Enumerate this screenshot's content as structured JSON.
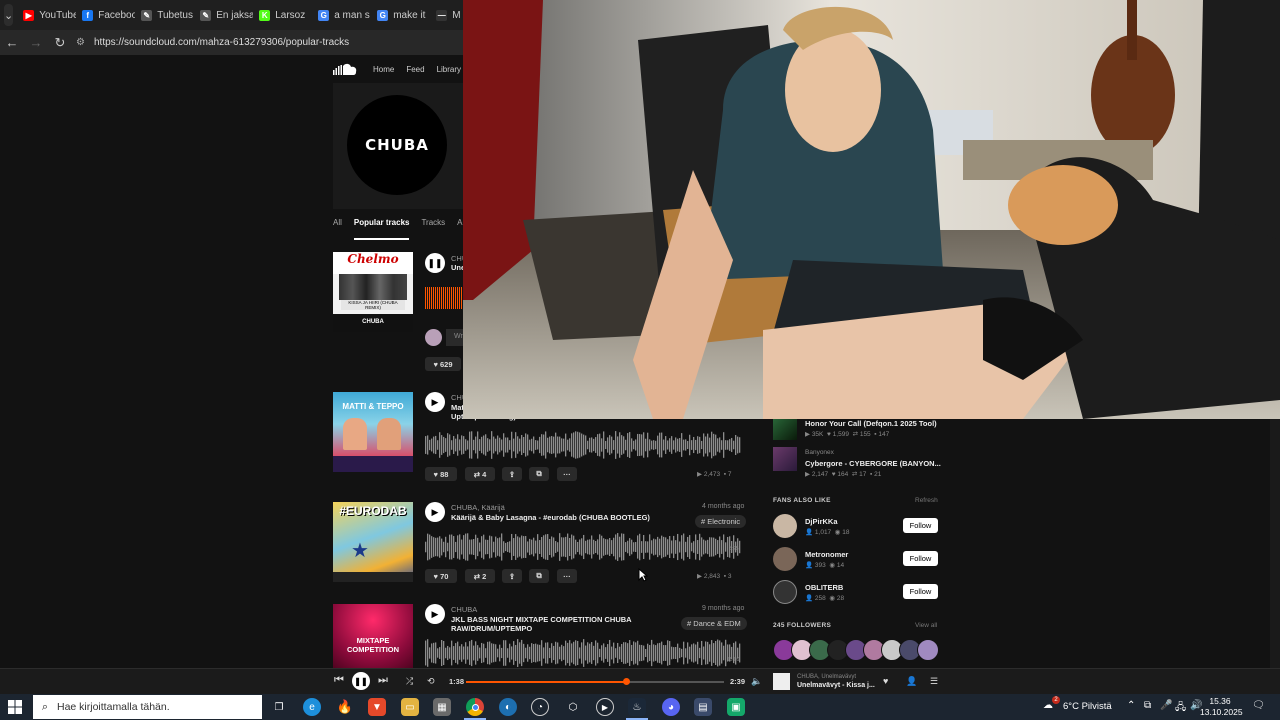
{
  "browser": {
    "tabs": [
      {
        "label": "YouTube",
        "color": "#ff0000",
        "glyph": "▶"
      },
      {
        "label": "Facebook",
        "color": "#1877f2",
        "glyph": "f"
      },
      {
        "label": "Tubetus",
        "color": "#555555",
        "glyph": "✎"
      },
      {
        "label": "En jaksa",
        "color": "#555555",
        "glyph": "✎"
      },
      {
        "label": "Larsoz",
        "color": "#53fc18",
        "glyph": "K"
      },
      {
        "label": "a man s",
        "color": "#4285f4",
        "glyph": "G"
      },
      {
        "label": "make it",
        "color": "#4285f4",
        "glyph": "G"
      },
      {
        "label": "M",
        "color": "#333333",
        "glyph": "—"
      }
    ],
    "url": "https://soundcloud.com/mahza-613279306/popular-tracks"
  },
  "soundcloud": {
    "nav": [
      "Home",
      "Feed",
      "Library"
    ],
    "profile_name": "CHUBA",
    "profile_tabs": [
      "All",
      "Popular tracks",
      "Tracks",
      "Alb"
    ],
    "tracks": [
      {
        "artist": "CHU",
        "title": "Une",
        "likes": "629",
        "comment_placeholder": "Wr",
        "art_caption": "KISSA JA HIIRI (CHUBA REMIX)",
        "art_footer": "CHUBA"
      },
      {
        "artist": "CHU",
        "title": "Mat",
        "title2": "Uptempo Bootleg)",
        "likes": "88",
        "reposts": "4",
        "plays": "2,473",
        "comments": "7",
        "art_caption": "MATTI & TEPPO"
      },
      {
        "artist": "CHUBA, Käärijä",
        "title": "Käärijä & Baby Lasagna - #eurodab (CHUBA BOOTLEG)",
        "ago": "4 months ago",
        "tag": "# Electronic",
        "likes": "70",
        "reposts": "2",
        "plays": "2,843",
        "comments": "3",
        "duration": "3:25",
        "art_caption": "#EURODAB"
      },
      {
        "artist": "CHUBA",
        "title": "JKL BASS NIGHT MIXTAPE COMPETITION CHUBA",
        "title2": "RAW/DRUM/UPTEMPO",
        "ago": "9 months ago",
        "tag": "# Dance & EDM",
        "duration": "15:09",
        "art_caption": "MIXTAPE COMPETITION"
      }
    ],
    "sidebar": {
      "liked": [
        {
          "artist": "",
          "title": "Honor Your Call (Defqon.1 2025 Tool)",
          "plays": "35K",
          "likes": "1,599",
          "reposts": "155",
          "comments": "147"
        },
        {
          "artist": "Banyonex",
          "title": "Cybergore - CYBERGORE (BANYON...",
          "plays": "2,147",
          "likes": "164",
          "reposts": "17",
          "comments": "21"
        }
      ],
      "fans_heading": "FANS ALSO LIKE",
      "refresh_label": "Refresh",
      "fans": [
        {
          "name": "DjPirKKa",
          "followers": "1,017",
          "tracks": "18",
          "color": "#c9b7a4"
        },
        {
          "name": "Metronomer",
          "followers": "393",
          "tracks": "14",
          "color": "#7a6658"
        },
        {
          "name": "OBLITERB",
          "followers": "258",
          "tracks": "28",
          "color": "#333333"
        }
      ],
      "follow_label": "Follow",
      "followers_heading": "245 FOLLOWERS",
      "view_all_label": "View all"
    }
  },
  "player": {
    "elapsed": "1:38",
    "total": "2:39",
    "progress": 0.62,
    "track_artist": "CHUBA, Unelmavävyt",
    "track_title": "Unelmavävyt - Kissa j..."
  },
  "taskbar": {
    "search_placeholder": "Hae kirjoittamalla tähän.",
    "weather": "6°C  Pilvistä",
    "weather_badge": "2",
    "time": "15.36",
    "date": "13.10.2025"
  }
}
